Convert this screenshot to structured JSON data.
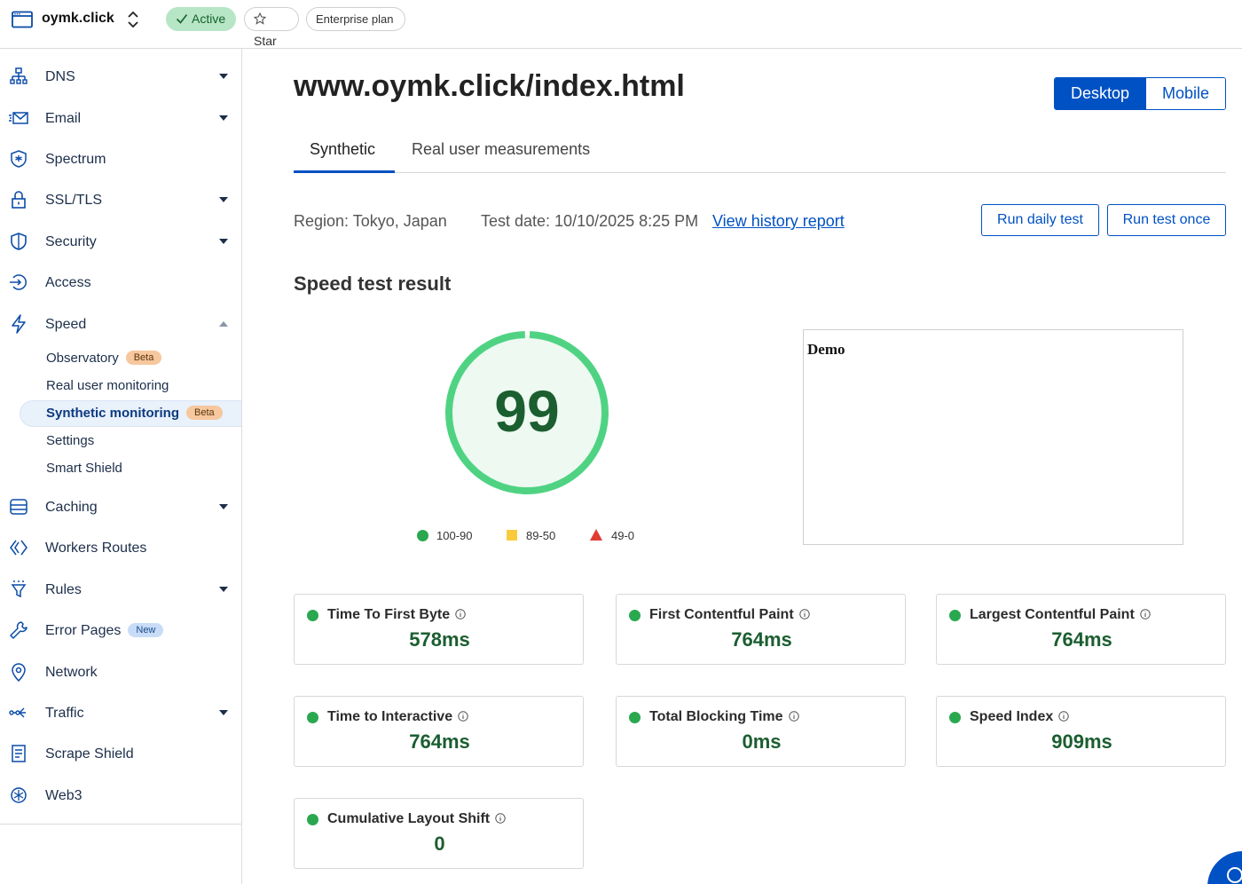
{
  "header": {
    "site_name": "oymk.click",
    "status": "Active",
    "star": "Star",
    "plan": "Enterprise plan"
  },
  "sidebar": {
    "items": [
      {
        "label": "DNS",
        "icon": "dns-icon",
        "expandable": true
      },
      {
        "label": "Email",
        "icon": "email-icon",
        "expandable": true
      },
      {
        "label": "Spectrum",
        "icon": "spectrum-icon",
        "expandable": false
      },
      {
        "label": "SSL/TLS",
        "icon": "lock-icon",
        "expandable": true
      },
      {
        "label": "Security",
        "icon": "shield-icon",
        "expandable": true
      },
      {
        "label": "Access",
        "icon": "access-icon",
        "expandable": false
      },
      {
        "label": "Speed",
        "icon": "bolt-icon",
        "expandable": true,
        "expanded": true
      },
      {
        "label": "Caching",
        "icon": "caching-icon",
        "expandable": true
      },
      {
        "label": "Workers Routes",
        "icon": "workers-icon",
        "expandable": false
      },
      {
        "label": "Rules",
        "icon": "rules-icon",
        "expandable": true
      },
      {
        "label": "Error Pages",
        "icon": "wrench-icon",
        "expandable": false,
        "badge": "New"
      },
      {
        "label": "Network",
        "icon": "location-pin-icon",
        "expandable": false
      },
      {
        "label": "Traffic",
        "icon": "traffic-icon",
        "expandable": true
      },
      {
        "label": "Scrape Shield",
        "icon": "document-icon",
        "expandable": false
      },
      {
        "label": "Web3",
        "icon": "web3-icon",
        "expandable": false
      }
    ],
    "speed_subitems": [
      {
        "label": "Observatory",
        "badge": "Beta"
      },
      {
        "label": "Real user monitoring"
      },
      {
        "label": "Synthetic monitoring",
        "badge": "Beta",
        "selected": true
      },
      {
        "label": "Settings"
      },
      {
        "label": "Smart Shield"
      }
    ]
  },
  "main": {
    "title": "www.oymk.click/index.html",
    "device_toggle": {
      "desktop": "Desktop",
      "mobile": "Mobile",
      "selected": "Desktop"
    },
    "tabs": [
      {
        "label": "Synthetic",
        "active": true
      },
      {
        "label": "Real user measurements",
        "active": false
      }
    ],
    "region": "Region: Tokyo, Japan",
    "test_date": "Test date: 10/10/2025 8:25 PM",
    "history_link": "View history report",
    "run_daily": "Run daily test",
    "run_once": "Run test once",
    "section_title": "Speed test result",
    "score": "99",
    "score_fraction": 0.99,
    "legend": {
      "good": "100-90",
      "average": "89-50",
      "poor": "49-0"
    },
    "preview_text": "Demo",
    "metrics": [
      {
        "name": "Time To First Byte",
        "value": "578ms"
      },
      {
        "name": "First Contentful Paint",
        "value": "764ms"
      },
      {
        "name": "Largest Contentful Paint",
        "value": "764ms"
      },
      {
        "name": "Time to Interactive",
        "value": "764ms"
      },
      {
        "name": "Total Blocking Time",
        "value": "0ms"
      },
      {
        "name": "Speed Index",
        "value": "909ms"
      },
      {
        "name": "Cumulative Layout Shift",
        "value": "0"
      }
    ]
  },
  "colors": {
    "accent": "#0051c3",
    "good": "#2aa850",
    "gauge_ring": "#4fd383",
    "gauge_fill": "#edf9f1",
    "score_text": "#1b5e30"
  }
}
